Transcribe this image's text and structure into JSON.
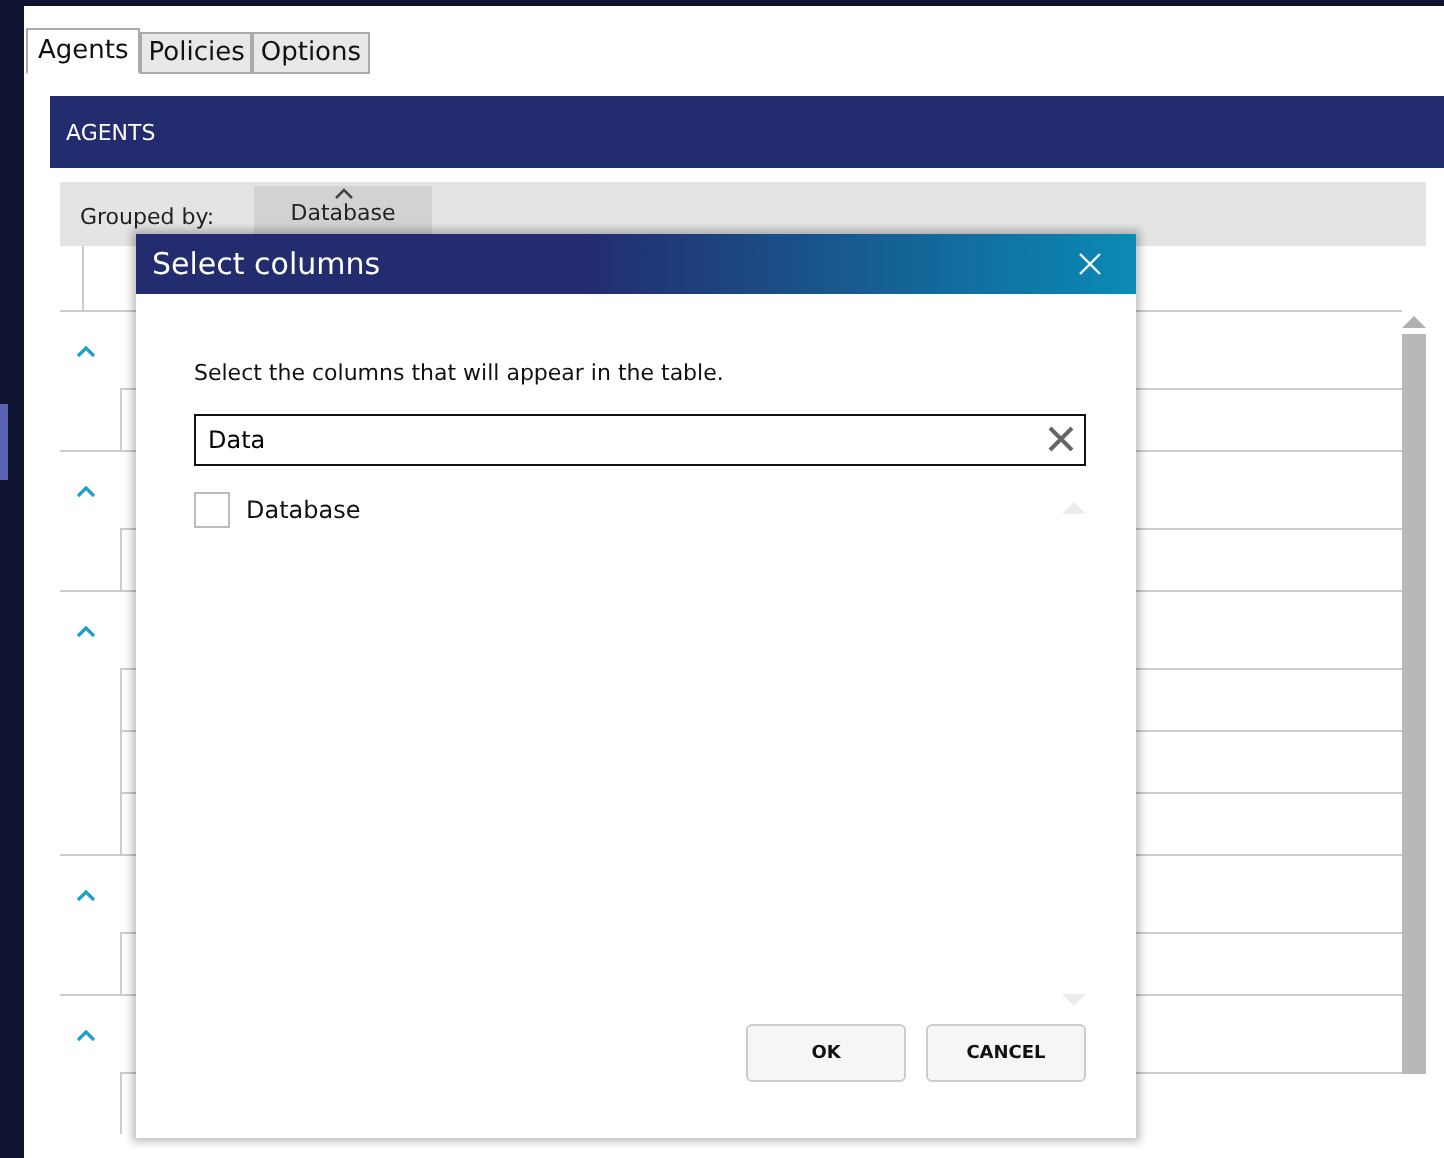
{
  "tabs": [
    {
      "label": "Agents",
      "selected": true
    },
    {
      "label": "Policies",
      "selected": false
    },
    {
      "label": "Options",
      "selected": false
    }
  ],
  "panel": {
    "title": "AGENTS",
    "grouped_by_label": "Grouped by:",
    "group_column": "Database"
  },
  "groups": [
    {
      "expanded": true
    },
    {
      "expanded": true
    },
    {
      "expanded": true
    },
    {
      "expanded": true
    },
    {
      "expanded": true
    }
  ],
  "dialog": {
    "title": "Select columns",
    "instruction": "Select the columns that will appear in the table.",
    "search_value": "Data",
    "columns": [
      {
        "label": "Database",
        "checked": false
      }
    ],
    "buttons": [
      "OK",
      "CANCEL"
    ]
  }
}
